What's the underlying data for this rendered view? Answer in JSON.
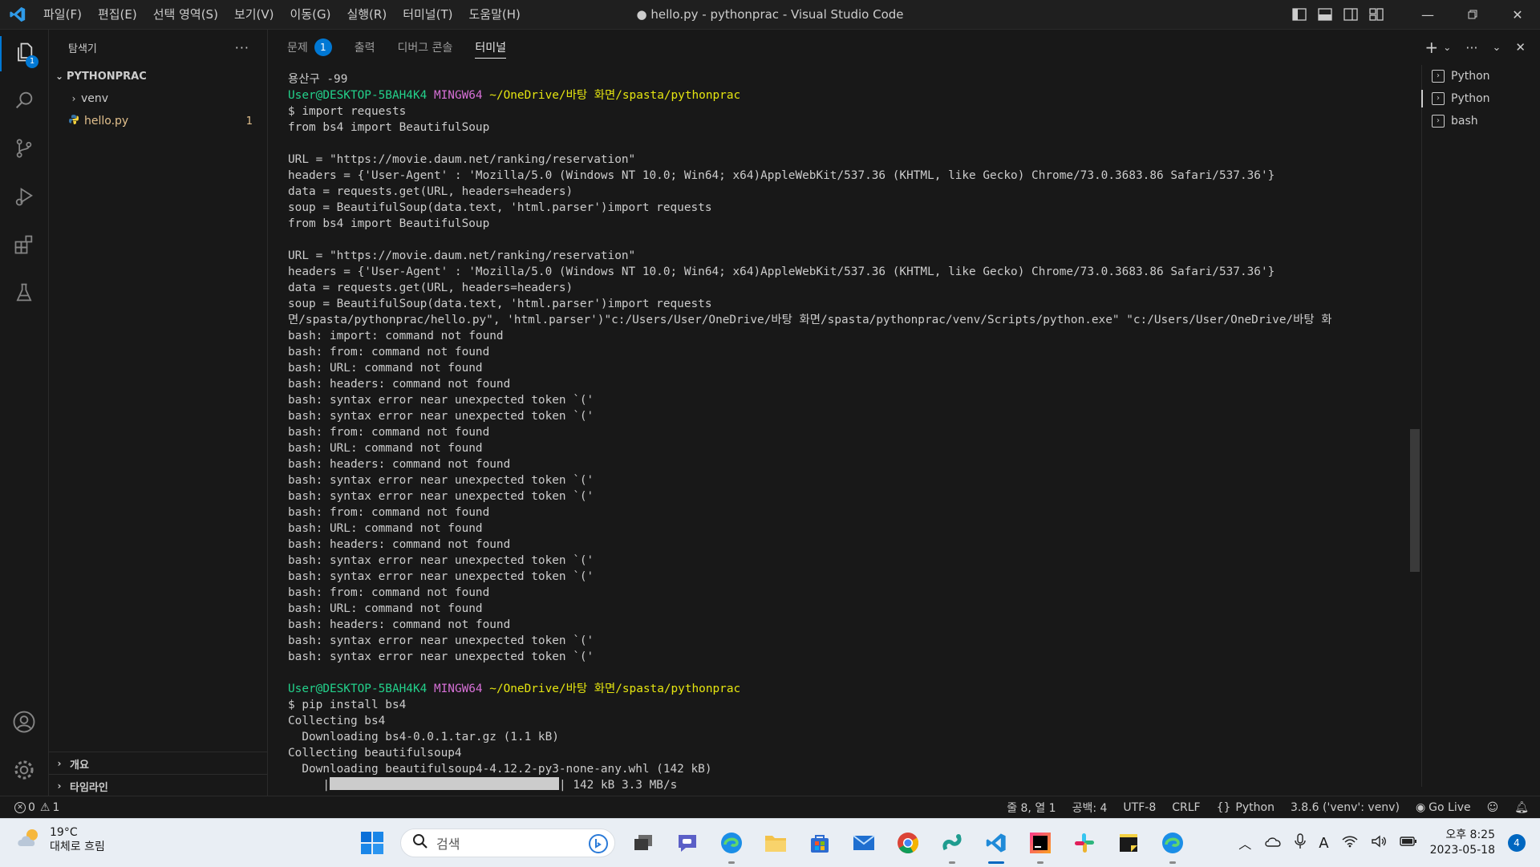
{
  "titlebar": {
    "menu": [
      "파일(F)",
      "편집(E)",
      "선택 영역(S)",
      "보기(V)",
      "이동(G)",
      "실행(R)",
      "터미널(T)",
      "도움말(H)"
    ],
    "title": "● hello.py - pythonprac - Visual Studio Code"
  },
  "activity": {
    "explorer_badge": "1"
  },
  "sidebar": {
    "title": "탐색기",
    "folder": "PYTHONPRAC",
    "items": [
      {
        "label": "venv"
      },
      {
        "label": "hello.py",
        "badge": "1"
      }
    ],
    "outline": "개요",
    "timeline": "타임라인"
  },
  "panel": {
    "tabs": [
      {
        "label": "문제",
        "badge": "1"
      },
      {
        "label": "출력"
      },
      {
        "label": "디버그 콘솔"
      },
      {
        "label": "터미널"
      }
    ],
    "terminals": [
      "Python",
      "Python",
      "bash"
    ]
  },
  "terminal": {
    "lines": [
      "용산구 -99",
      {
        "prompt": true
      },
      "$ import requests",
      "from bs4 import BeautifulSoup",
      "",
      "URL = \"https://movie.daum.net/ranking/reservation\"",
      "headers = {'User-Agent' : 'Mozilla/5.0 (Windows NT 10.0; Win64; x64)AppleWebKit/537.36 (KHTML, like Gecko) Chrome/73.0.3683.86 Safari/537.36'}",
      "data = requests.get(URL, headers=headers)",
      "soup = BeautifulSoup(data.text, 'html.parser')import requests",
      "from bs4 import BeautifulSoup",
      "",
      "URL = \"https://movie.daum.net/ranking/reservation\"",
      "headers = {'User-Agent' : 'Mozilla/5.0 (Windows NT 10.0; Win64; x64)AppleWebKit/537.36 (KHTML, like Gecko) Chrome/73.0.3683.86 Safari/537.36'}",
      "data = requests.get(URL, headers=headers)",
      "soup = BeautifulSoup(data.text, 'html.parser')import requests",
      "면/spasta/pythonprac/hello.py\", 'html.parser')\"c:/Users/User/OneDrive/바탕 화면/spasta/pythonprac/venv/Scripts/python.exe\" \"c:/Users/User/OneDrive/바탕 화",
      "bash: import: command not found",
      "bash: from: command not found",
      "bash: URL: command not found",
      "bash: headers: command not found",
      "bash: syntax error near unexpected token `('",
      "bash: syntax error near unexpected token `('",
      "bash: from: command not found",
      "bash: URL: command not found",
      "bash: headers: command not found",
      "bash: syntax error near unexpected token `('",
      "bash: syntax error near unexpected token `('",
      "bash: from: command not found",
      "bash: URL: command not found",
      "bash: headers: command not found",
      "bash: syntax error near unexpected token `('",
      "bash: syntax error near unexpected token `('",
      "bash: from: command not found",
      "bash: URL: command not found",
      "bash: headers: command not found",
      "bash: syntax error near unexpected token `('",
      "bash: syntax error near unexpected token `('",
      "",
      {
        "prompt": true
      },
      "$ pip install bs4",
      "Collecting bs4",
      "  Downloading bs4-0.0.1.tar.gz (1.1 kB)",
      "Collecting beautifulsoup4",
      "  Downloading beautifulsoup4-4.12.2-py3-none-any.whl (142 kB)",
      {
        "progress": true
      }
    ],
    "prompt_user": "User@DESKTOP-5BAH4K4",
    "prompt_env": "MINGW64",
    "prompt_path": "~/OneDrive/바탕 화면/spasta/pythonprac",
    "progress_text": "142 kB 3.3 MB/s"
  },
  "statusbar": {
    "errors": "0",
    "warnings": "1",
    "position": "줄 8, 열 1",
    "spaces": "공백: 4",
    "encoding": "UTF-8",
    "eol": "CRLF",
    "language": "Python",
    "interpreter": "3.8.6 ('venv': venv)",
    "golive": "Go Live"
  },
  "taskbar": {
    "temp": "19°C",
    "weather": "대체로 흐림",
    "search_placeholder": "검색",
    "time": "오후 8:25",
    "date": "2023-05-18",
    "notifications": "4"
  },
  "colors": {
    "accent": "#0078d4",
    "prompt_green": "#23d18b",
    "prompt_magenta": "#d670d6",
    "prompt_yellow": "#e5e510"
  }
}
